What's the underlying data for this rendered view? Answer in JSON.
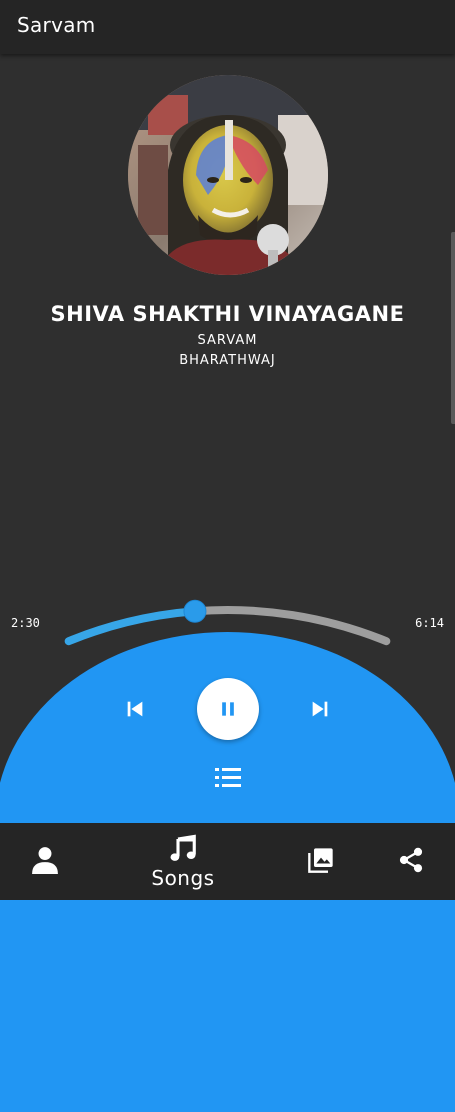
{
  "app": {
    "title": "Sarvam"
  },
  "now_playing": {
    "title": "SHIVA SHAKTHI VINAYAGANE",
    "album": "SARVAM",
    "artist": "BHARATHWAJ",
    "elapsed": "2:30",
    "duration": "6:14",
    "progress_fraction": 0.4
  },
  "controls": {
    "previous_icon": "skip-previous-icon",
    "play_state_icon": "pause-icon",
    "next_icon": "skip-next-icon",
    "queue_icon": "queue-list-icon"
  },
  "bottom_nav": {
    "items": [
      {
        "icon": "person-icon",
        "label": ""
      },
      {
        "icon": "music-note-icon",
        "label": "Songs"
      },
      {
        "icon": "photo-library-icon",
        "label": ""
      },
      {
        "icon": "share-icon",
        "label": ""
      }
    ]
  },
  "colors": {
    "accent": "#2196f3",
    "progress_played": "#37a6e8",
    "progress_remaining": "#9e9e9e",
    "background": "#2f2f2f",
    "bar": "#252525"
  }
}
